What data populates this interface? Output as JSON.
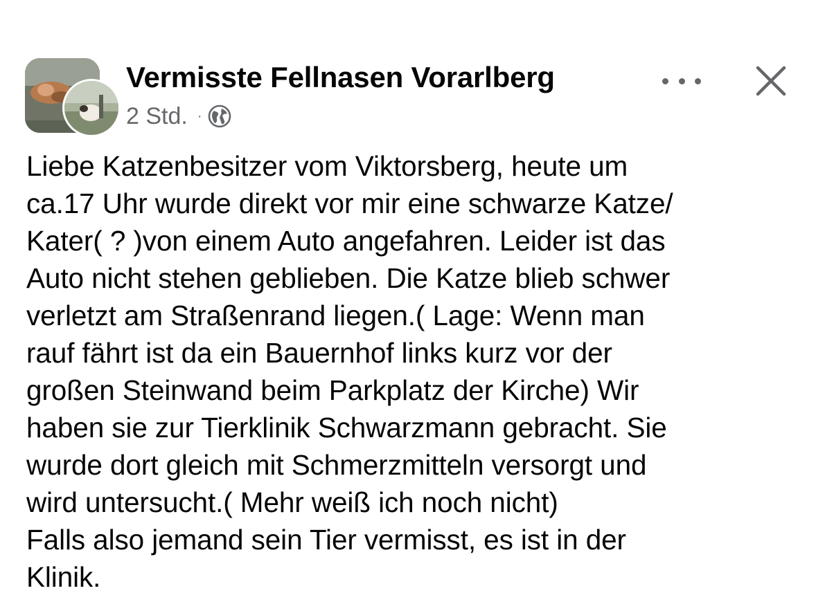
{
  "post": {
    "group_name": "Vermisste Fellnasen Vorarlberg",
    "time": "2 Std.",
    "separator": "·",
    "privacy_icon": "globe-icon",
    "more_icon": "more-horizontal-icon",
    "close_icon": "close-icon",
    "text_lines": [
      "Liebe Katzenbesitzer vom Viktorsberg, heute um",
      "ca.17 Uhr wurde direkt vor mir eine schwarze Katze/",
      "Kater( ? )von einem Auto angefahren. Leider ist das",
      "Auto nicht stehen geblieben. Die Katze blieb schwer",
      "verletzt am Straßenrand liegen.( Lage: Wenn man",
      "rauf fährt ist da ein Bauernhof links kurz vor der",
      "großen Steinwand beim Parkplatz der Kirche) Wir",
      "haben sie zur Tierklinik Schwarzmann gebracht. Sie",
      "wurde dort gleich mit Schmerzmitteln versorgt und",
      "wird untersucht.( Mehr weiß ich noch nicht)",
      "Falls also jemand sein Tier vermisst, es ist in der",
      "Klinik."
    ]
  },
  "colors": {
    "text": "#050505",
    "secondary": "#65676b",
    "background": "#ffffff"
  }
}
